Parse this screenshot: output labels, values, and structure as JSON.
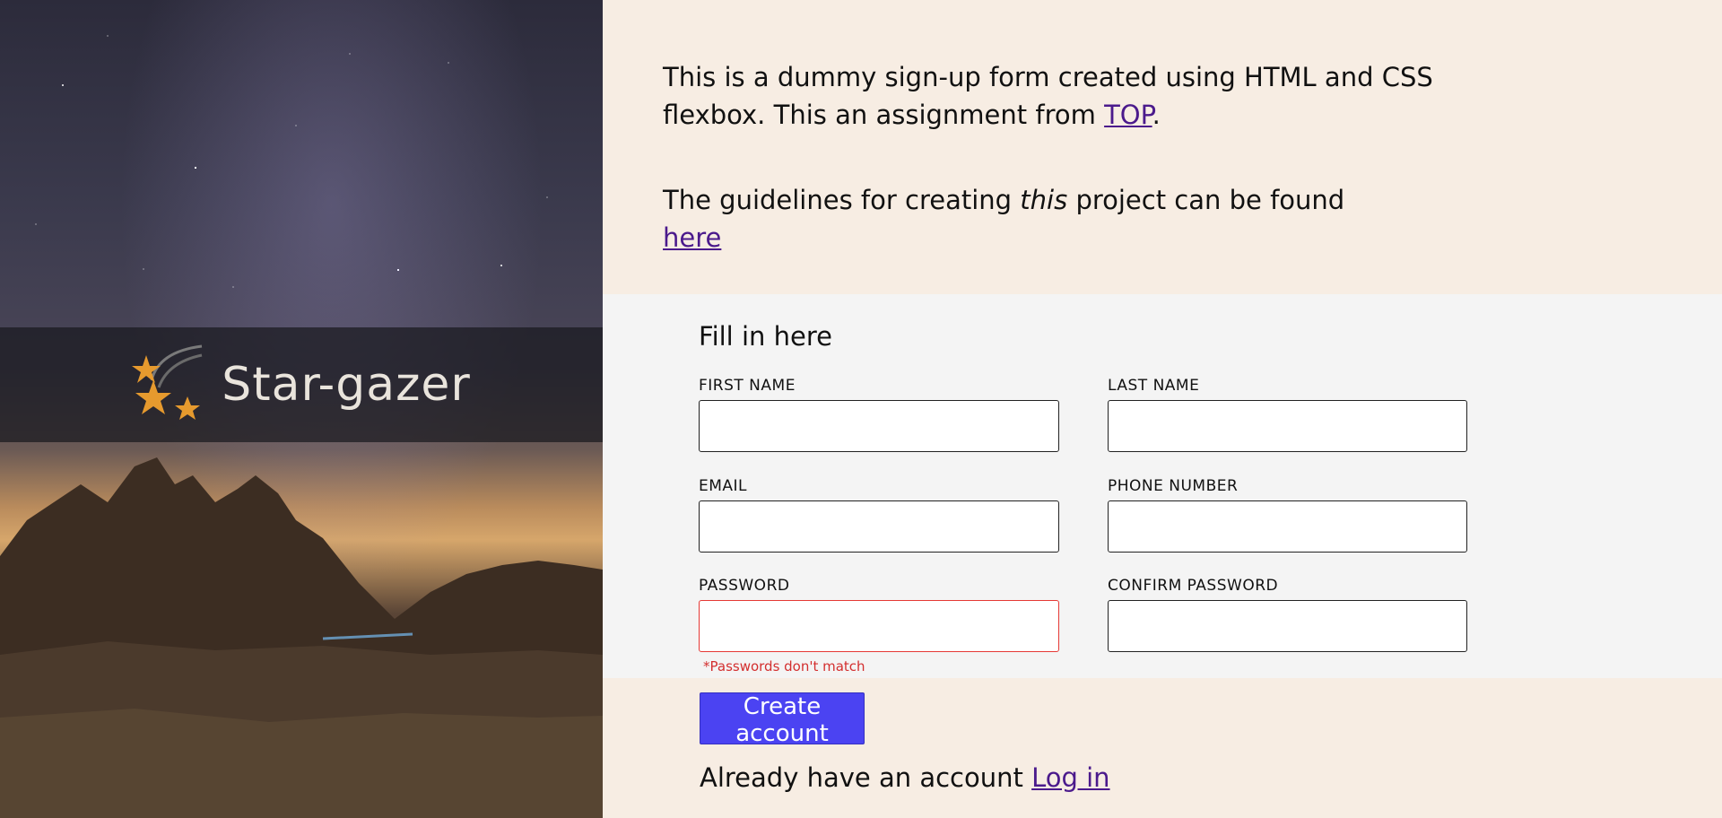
{
  "brand": {
    "name": "Star-gazer",
    "logo_icon": "stars-logo-icon",
    "accent_color": "#e69a2e"
  },
  "intro": {
    "p1_text": "This is a dummy sign-up form created using HTML and CSS flexbox. This an assignment from",
    "p1_link": "TOP",
    "p1_end": ".",
    "p2_text_before": "The guidelines for creating",
    "p2_emph": "this",
    "p2_text_after": "project can be found",
    "p2_link": "here"
  },
  "form": {
    "title": "Fill in here",
    "fields": {
      "first_name": {
        "label": "FIRST NAME",
        "value": ""
      },
      "last_name": {
        "label": "LAST NAME",
        "value": ""
      },
      "email": {
        "label": "EMAIL",
        "value": ""
      },
      "phone": {
        "label": "PHONE NUMBER",
        "value": ""
      },
      "password": {
        "label": "PASSWORD",
        "value": ""
      },
      "confirm_password": {
        "label": "CONFIRM PASSWORD",
        "value": ""
      }
    },
    "error": "*Passwords don't match",
    "error_color": "#d32f2f"
  },
  "actions": {
    "create_label": "Create account",
    "button_color": "#4b43f2",
    "login_text": "Already have an account",
    "login_link": "Log in"
  }
}
